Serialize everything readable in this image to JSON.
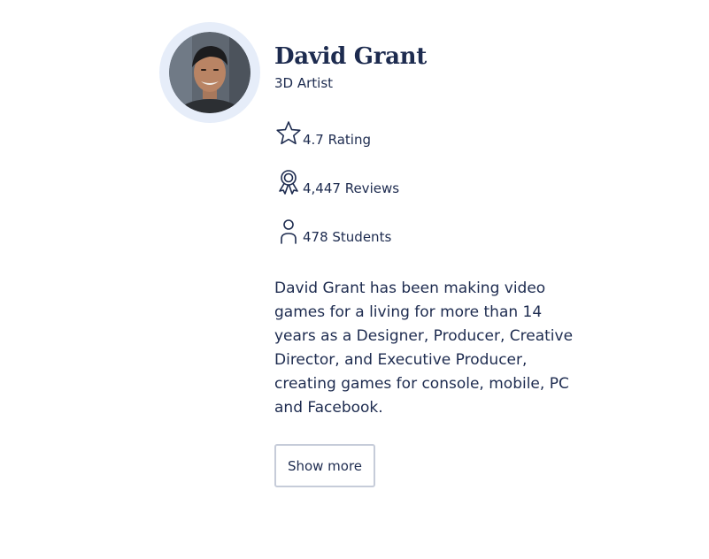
{
  "profile": {
    "name": "David Grant",
    "role": "3D Artist",
    "avatar_icon": "user-photo-avatar"
  },
  "stats": [
    {
      "icon": "star-icon",
      "label": "4.7 Rating"
    },
    {
      "icon": "award-icon",
      "label": "4,447 Reviews"
    },
    {
      "icon": "user-icon",
      "label": "478 Students"
    }
  ],
  "bio": "David Grant has been making video games for a living for more than 14 years as a Designer, Producer, Creative Director, and Executive Producer, creating games for console, mobile, PC and Facebook.",
  "show_more_label": "Show more",
  "colors": {
    "text": "#1d2b4f",
    "avatar_ring": "#e6edf9",
    "button_border": "#c6ccd9"
  }
}
